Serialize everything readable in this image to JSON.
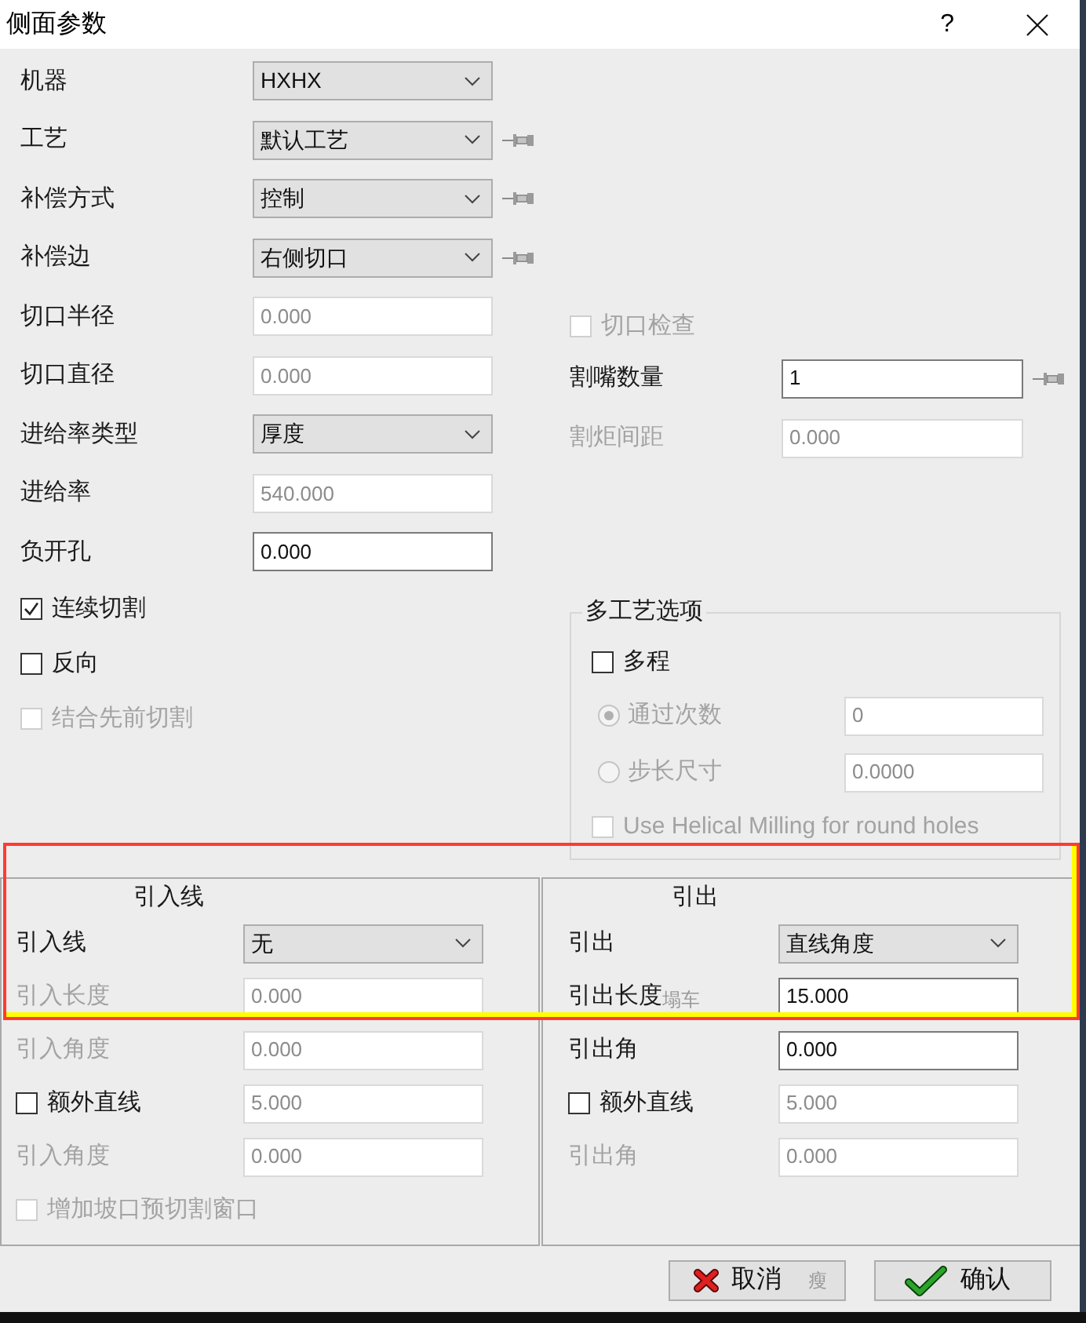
{
  "window": {
    "title": "侧面参数",
    "help": "?"
  },
  "settings": [
    {
      "kind": "select",
      "label": "机器",
      "label_disabled": false,
      "value": "HXHX",
      "disabled": false,
      "pinned": false
    },
    {
      "kind": "select",
      "label": "工艺",
      "label_disabled": false,
      "value": "默认工艺",
      "disabled": false,
      "pinned": true
    },
    {
      "kind": "select",
      "label": "补偿方式",
      "label_disabled": false,
      "value": "控制",
      "disabled": false,
      "pinned": true
    },
    {
      "kind": "select",
      "label": "补偿边",
      "label_disabled": false,
      "value": "右侧切口",
      "disabled": false,
      "pinned": true
    },
    {
      "kind": "input",
      "label": "切口半径",
      "label_disabled": false,
      "value": "0.000",
      "disabled": true,
      "pinned": false
    },
    {
      "kind": "input",
      "label": "切口直径",
      "label_disabled": false,
      "value": "0.000",
      "disabled": true,
      "pinned": false
    },
    {
      "kind": "select",
      "label": "进给率类型",
      "label_disabled": false,
      "value": "厚度",
      "disabled": false,
      "pinned": false
    },
    {
      "kind": "input",
      "label": "进给率",
      "label_disabled": false,
      "value": "540.000",
      "disabled": true,
      "pinned": false
    },
    {
      "kind": "input",
      "label": "负开孔",
      "label_disabled": false,
      "value": "0.000",
      "disabled": false,
      "pinned": false
    }
  ],
  "options": [
    {
      "kind": "check",
      "label": "连续切割",
      "label_disabled": false,
      "checked": true
    },
    {
      "kind": "check",
      "label": "反向",
      "label_disabled": false,
      "checked": false
    },
    {
      "kind": "check",
      "label": "结合先前切割",
      "label_disabled": true,
      "checked": false
    }
  ],
  "torch": [
    {
      "kind": "check",
      "label": "切口检查",
      "label_disabled": true,
      "checked": false
    },
    {
      "kind": "input",
      "label": "割嘴数量",
      "label_disabled": false,
      "value": "1",
      "disabled": false,
      "pinned": true
    },
    {
      "kind": "input",
      "label": "割炬间距",
      "label_disabled": true,
      "value": "0.000",
      "disabled": true,
      "pinned": false
    }
  ],
  "multi_process": {
    "title": "多工艺选项",
    "rows": [
      {
        "kind": "check",
        "label": "多程",
        "label_disabled": false,
        "checked": false
      },
      {
        "kind": "radio_input",
        "label": "通过次数",
        "label_disabled": true,
        "selected": true,
        "value": "0",
        "disabled": true
      },
      {
        "kind": "radio_input",
        "label": "步长尺寸",
        "label_disabled": true,
        "selected": false,
        "value": "0.0000",
        "disabled": true
      },
      {
        "kind": "check",
        "label": "Use Helical Milling for round holes",
        "label_disabled": true,
        "checked": false
      }
    ]
  },
  "lead_in": {
    "title": "引入线",
    "rows": [
      {
        "kind": "select",
        "label": "引入线",
        "label_disabled": false,
        "value": "无",
        "disabled": false
      },
      {
        "kind": "input",
        "label": "引入长度",
        "label_disabled": true,
        "value": "0.000",
        "disabled": true
      },
      {
        "kind": "input",
        "label": "引入角度",
        "label_disabled": true,
        "value": "0.000",
        "disabled": true
      },
      {
        "kind": "check_input",
        "label": "额外直线",
        "label_disabled": false,
        "checked": false,
        "value": "5.000",
        "disabled": true
      },
      {
        "kind": "input",
        "label": "引入角度",
        "label_disabled": true,
        "value": "0.000",
        "disabled": true
      },
      {
        "kind": "check",
        "label": "增加坡口预切割窗口",
        "label_disabled": true,
        "checked": false
      }
    ]
  },
  "lead_out": {
    "title": "引出",
    "rows": [
      {
        "kind": "select",
        "label": "引出",
        "label_disabled": false,
        "value": "直线角度",
        "disabled": false
      },
      {
        "kind": "input",
        "label": "引出长度",
        "note": "塌车",
        "label_disabled": false,
        "value": "15.000",
        "disabled": false
      },
      {
        "kind": "input",
        "label": "引出角",
        "label_disabled": false,
        "value": "0.000",
        "disabled": false
      },
      {
        "kind": "check_input",
        "label": "额外直线",
        "label_disabled": false,
        "checked": false,
        "value": "5.000",
        "disabled": true
      },
      {
        "kind": "input",
        "label": "引出角",
        "label_disabled": true,
        "value": "0.000",
        "disabled": true
      }
    ]
  },
  "buttons": [
    {
      "kind": "cancel",
      "label": "取消",
      "note": "瘦"
    },
    {
      "kind": "ok",
      "label": "确认"
    }
  ]
}
